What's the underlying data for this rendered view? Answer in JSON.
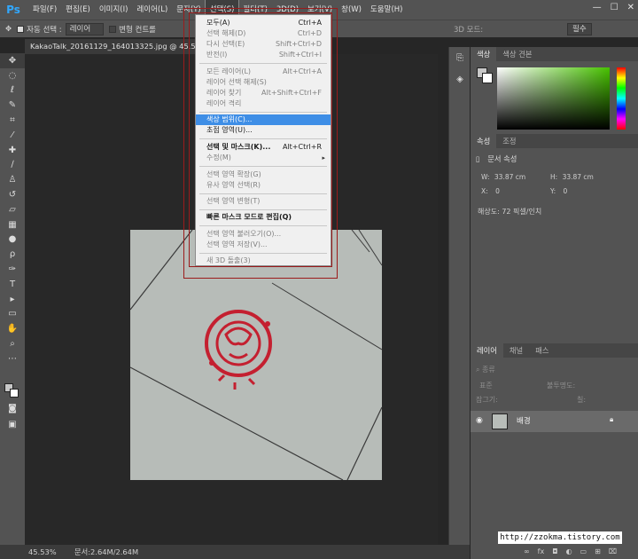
{
  "app": {
    "logo": "Ps"
  },
  "menubar": {
    "items": [
      "파일(F)",
      "편집(E)",
      "이미지(I)",
      "레이어(L)",
      "문자(Y)",
      "선택(S)",
      "필터(T)",
      "3D(D)",
      "보기(V)",
      "창(W)",
      "도움말(H)"
    ],
    "active_index": 5,
    "window_controls": [
      "—",
      "☐",
      "✕"
    ]
  },
  "options_bar": {
    "move_icon": "move-icon",
    "auto_select_label": "자동 선택 :",
    "auto_select_value": "레이어",
    "transform_label": "변형 컨트롤",
    "mode_3d_label": "3D 모드:",
    "workspace_label": "필수"
  },
  "document": {
    "tab_title": "KakaoTalk_20161129_164013325.jpg @ 45.5% (RGB/8)"
  },
  "status_bar": {
    "zoom": "45.53%",
    "doc_info": "문서:2.64M/2.64M"
  },
  "color_panel": {
    "tabs": [
      "색상",
      "색상 견본"
    ],
    "active_tab": 0,
    "foreground_color": "#c8c8c8",
    "background_color": "#ffffff",
    "field_hue": "#47c200"
  },
  "properties_panel": {
    "tabs": [
      "속성",
      "조정"
    ],
    "active_tab": 0,
    "header": "문서 속성",
    "w_label": "W:",
    "w_value": "33.87 cm",
    "h_label": "H:",
    "h_value": "33.87 cm",
    "x_label": "X:",
    "x_value": "0",
    "y_label": "Y:",
    "y_value": "0",
    "resolution": "해상도: 72 픽셀/인치"
  },
  "layers_panel": {
    "tabs": [
      "레이어",
      "채널",
      "패스"
    ],
    "active_tab": 0,
    "filter_label": "종류",
    "blend_mode": "표준",
    "opacity_label": "불투명도:",
    "lock_label": "잠그기:",
    "fill_label": "칠:",
    "layers": [
      {
        "name": "배경",
        "visible": true,
        "locked": true
      }
    ],
    "bottom_icons": [
      "link-icon",
      "fx-icon",
      "mask-icon",
      "adjustment-icon",
      "group-icon",
      "new-layer-icon",
      "trash-icon"
    ]
  },
  "select_menu": {
    "items": [
      {
        "label": "모두(A)",
        "shortcut": "Ctrl+A",
        "enabled": true
      },
      {
        "label": "선택 해제(D)",
        "shortcut": "Ctrl+D",
        "enabled": false
      },
      {
        "label": "다시 선택(E)",
        "shortcut": "Shift+Ctrl+D",
        "enabled": false
      },
      {
        "label": "반전(I)",
        "shortcut": "Shift+Ctrl+I",
        "enabled": false
      },
      {
        "label": "모든 레이어(L)",
        "shortcut": "Alt+Ctrl+A",
        "enabled": false
      },
      {
        "label": "레이어 선택 해제(S)",
        "shortcut": "",
        "enabled": false
      },
      {
        "label": "레이어 찾기",
        "shortcut": "Alt+Shift+Ctrl+F",
        "enabled": false
      },
      {
        "label": "레이어 격리",
        "shortcut": "",
        "enabled": false
      },
      {
        "label": "색상 범위(C)...",
        "shortcut": "",
        "enabled": true,
        "highlighted": true
      },
      {
        "label": "초점 영역(U)...",
        "shortcut": "",
        "enabled": true
      },
      {
        "label": "선택 및 마스크(K)...",
        "shortcut": "Alt+Ctrl+R",
        "enabled": true
      },
      {
        "label": "수정(M)",
        "shortcut": "",
        "enabled": false,
        "submenu": true
      },
      {
        "label": "선택 영역 확장(G)",
        "shortcut": "",
        "enabled": false
      },
      {
        "label": "유사 영역 선택(R)",
        "shortcut": "",
        "enabled": false
      },
      {
        "label": "선택 영역 변형(T)",
        "shortcut": "",
        "enabled": false
      },
      {
        "label": "빠른 마스크 모드로 편집(Q)",
        "shortcut": "",
        "enabled": true
      },
      {
        "label": "선택 영역 불러오기(O)...",
        "shortcut": "",
        "enabled": false
      },
      {
        "label": "선택 영역 저장(V)...",
        "shortcut": "",
        "enabled": false
      },
      {
        "label": "새 3D 돌출(3)",
        "shortcut": "",
        "enabled": false
      }
    ]
  },
  "watermark": "http://zzokma.tistory.com"
}
